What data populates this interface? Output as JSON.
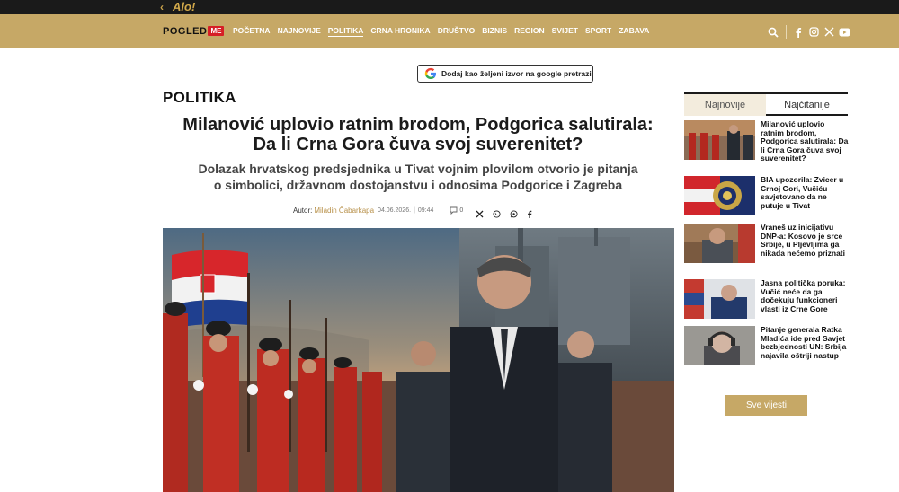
{
  "topbar": {
    "back_glyph": "‹",
    "brand": "Alo!"
  },
  "logo": {
    "text": "POGLED",
    "badge": "ME"
  },
  "menu": [
    {
      "label": "POČETNA"
    },
    {
      "label": "NAJNOVIJE"
    },
    {
      "label": "POLITIKA",
      "active": true
    },
    {
      "label": "CRNA HRONIKA"
    },
    {
      "label": "DRUŠTVO"
    },
    {
      "label": "BIZNIS"
    },
    {
      "label": "REGION"
    },
    {
      "label": "SVIJET"
    },
    {
      "label": "SPORT"
    },
    {
      "label": "ZABAVA"
    }
  ],
  "google_button": {
    "label": "Dodaj kao željeni izvor na google pretrazi"
  },
  "section": "POLITIKA",
  "article": {
    "headline": "Milanović uplovio ratnim brodom, Podgorica salutirala: Da li Crna Gora čuva svoj suverenitet?",
    "subheadline": "Dolazak hrvatskog predsjednika u Tivat vojnim plovilom otvorio je pitanja o simbolici, državnom dostojanstvu i odnosima Podgorice i Zagreba",
    "author_label": "Autor:",
    "author": "Miladin Čabarkapa",
    "date": "04.06.2026.",
    "separator": "|",
    "time": "09:44",
    "comments": "0"
  },
  "sidebar": {
    "tabs": [
      "Najnovije",
      "Najčitanije"
    ],
    "news": [
      {
        "title": "Milanović uplovio ratnim brodom, Podgorica salutirala: Da li Crna Gora čuva svoj suverenitet?"
      },
      {
        "title": "BIA upozorila: Zvicer u Crnoj Gori, Vučiću savjetovano da ne putuje u Tivat"
      },
      {
        "title": "Vraneš uz inicijativu DNP-a: Kosovo je srce Srbije, u Pljevljima ga nikada nećemo priznati"
      },
      {
        "title": "Jasna politička poruka: Vučić neće da ga dočekuju funkcioneri vlasti iz Crne Gore"
      },
      {
        "title": "Pitanje generala Ratka Mladića ide pred Savjet bezbjednosti UN: Srbija najavila oštriji nastup"
      }
    ],
    "all_button": "Sve vijesti"
  },
  "colors": {
    "gold": "#c6a866",
    "topbar": "#1a1a1a",
    "brand_red": "#d61f26"
  },
  "icons": [
    "search-icon",
    "facebook-icon",
    "instagram-icon",
    "x-icon",
    "youtube-icon",
    "comment-icon",
    "share-x-icon",
    "viber-icon",
    "whatsapp-icon",
    "share-facebook-icon"
  ]
}
